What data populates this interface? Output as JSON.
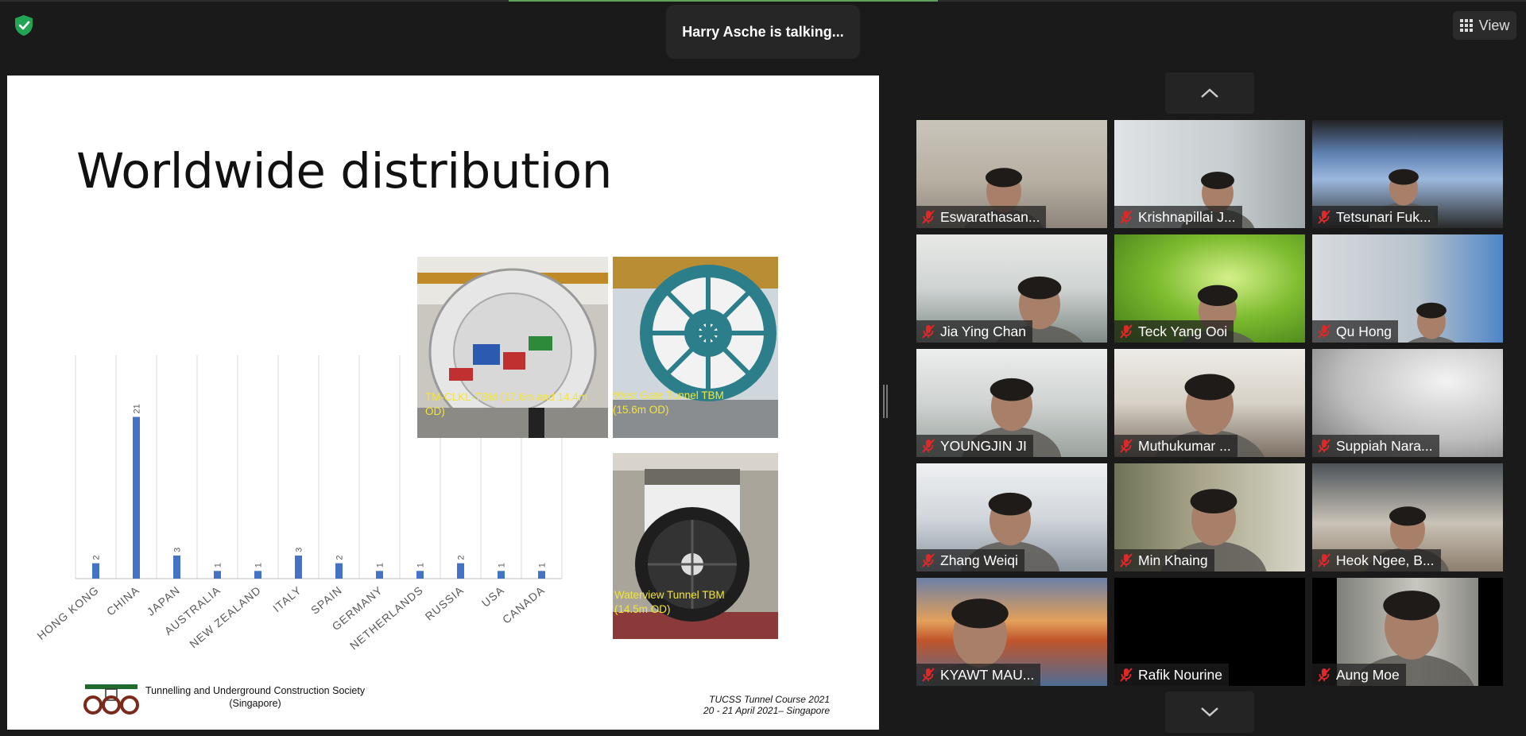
{
  "header": {
    "talking_indicator": "Harry Asche is talking...",
    "view_label": "View",
    "security_icon": "shield-check-icon",
    "view_icon": "grid-icon",
    "accent_green": "#5fa35a"
  },
  "slide": {
    "title": "Worldwide distribution",
    "org_line1": "Tunnelling and Underground Construction Society",
    "org_line2": "(Singapore)",
    "course_line1": "TUCSS Tunnel Course 2021",
    "course_line2": "20 - 21 April 2021– Singapore",
    "photos": [
      {
        "caption_line1": "TM-CLKL-TBM (17.6m and 14.4m",
        "caption_line2": "OD)"
      },
      {
        "caption_line1": "West Gate Tunnel TBM",
        "caption_line2": "(15.6m OD)"
      },
      {
        "caption_line1": "Waterview Tunnel TBM",
        "caption_line2": "(14.5m OD)"
      }
    ]
  },
  "chart_data": {
    "type": "bar",
    "categories": [
      "HONG KONG",
      "CHINA",
      "JAPAN",
      "AUSTRALIA",
      "NEW ZEALAND",
      "ITALY",
      "SPAIN",
      "GERMANY",
      "NETHERLANDS",
      "RUSSIA",
      "USA",
      "CANADA"
    ],
    "values": [
      2,
      21,
      3,
      1,
      1,
      3,
      2,
      1,
      1,
      2,
      1,
      1
    ],
    "ylim": [
      0,
      29
    ],
    "bar_color": "#4472c4",
    "grid": true
  },
  "gallery": {
    "scroll_up_icon": "chevron-up-icon",
    "scroll_down_icon": "chevron-down-icon",
    "mute_icon": "mic-muted-icon",
    "mute_color": "#e02828",
    "participants": [
      {
        "name": "Eswarathasan..."
      },
      {
        "name": "Krishnapillai J..."
      },
      {
        "name": "Tetsunari Fuk..."
      },
      {
        "name": "Jia Ying Chan"
      },
      {
        "name": "Teck Yang Ooi"
      },
      {
        "name": "Qu Hong"
      },
      {
        "name": "YOUNGJIN JI"
      },
      {
        "name": "Muthukumar ..."
      },
      {
        "name": "Suppiah Nara..."
      },
      {
        "name": "Zhang Weiqi"
      },
      {
        "name": "Min Khaing"
      },
      {
        "name": "Heok Ngee, B..."
      },
      {
        "name": "KYAWT MAU..."
      },
      {
        "name": "Rafik Nourine"
      },
      {
        "name": "Aung Moe"
      }
    ]
  }
}
